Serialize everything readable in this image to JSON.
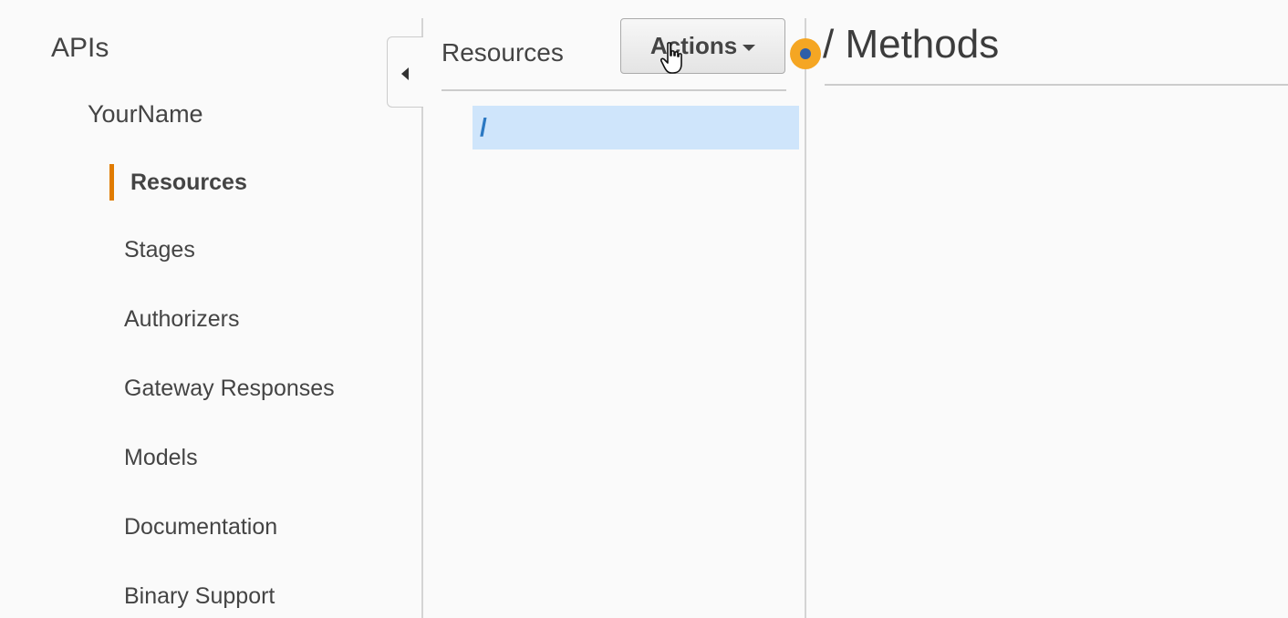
{
  "nav": {
    "apis_label": "APIs",
    "api_name": "YourName",
    "active_item": "Resources",
    "items": [
      "Stages",
      "Authorizers",
      "Gateway Responses",
      "Models",
      "Documentation",
      "Binary Support"
    ]
  },
  "resources_panel": {
    "title": "Resources",
    "actions_label": "Actions",
    "selected_path": "/"
  },
  "methods_panel": {
    "title": "/ Methods"
  },
  "colors": {
    "active_indicator": "#e07b00",
    "selected_row": "#cfe5fb",
    "path_text": "#2b78c2",
    "click_highlight": "#f5a623"
  },
  "icons": [
    "collapse-arrow-icon",
    "dropdown-caret-icon",
    "hand-cursor-icon",
    "click-indicator-icon"
  ]
}
